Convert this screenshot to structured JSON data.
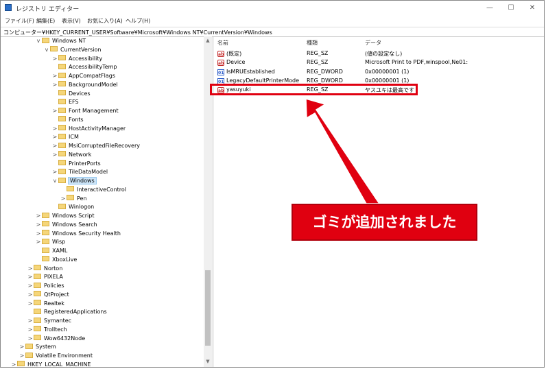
{
  "window": {
    "title": "レジストリ エディター",
    "minimize": "—",
    "maximize": "☐",
    "close": "✕"
  },
  "menu": [
    "ファイル(F)",
    "編集(E)",
    "表示(V)",
    "お気に入り(A)",
    "ヘルプ(H)"
  ],
  "address": "コンピューター¥HKEY_CURRENT_USER¥Software¥Microsoft¥Windows NT¥CurrentVersion¥Windows",
  "tree": [
    {
      "label": "Windows NT",
      "level": 4,
      "expander": "v"
    },
    {
      "label": "CurrentVersion",
      "level": 5,
      "expander": "v"
    },
    {
      "label": "Accessibility",
      "level": 6,
      "expander": ">"
    },
    {
      "label": "AccessibilityTemp",
      "level": 6,
      "expander": ""
    },
    {
      "label": "AppCompatFlags",
      "level": 6,
      "expander": ">"
    },
    {
      "label": "BackgroundModel",
      "level": 6,
      "expander": ">"
    },
    {
      "label": "Devices",
      "level": 6,
      "expander": ""
    },
    {
      "label": "EFS",
      "level": 6,
      "expander": ""
    },
    {
      "label": "Font Management",
      "level": 6,
      "expander": ">"
    },
    {
      "label": "Fonts",
      "level": 6,
      "expander": ""
    },
    {
      "label": "HostActivityManager",
      "level": 6,
      "expander": ">"
    },
    {
      "label": "ICM",
      "level": 6,
      "expander": ">"
    },
    {
      "label": "MsiCorruptedFileRecovery",
      "level": 6,
      "expander": ">"
    },
    {
      "label": "Network",
      "level": 6,
      "expander": ">"
    },
    {
      "label": "PrinterPorts",
      "level": 6,
      "expander": ""
    },
    {
      "label": "TileDataModel",
      "level": 6,
      "expander": ">"
    },
    {
      "label": "Windows",
      "level": 6,
      "expander": "v",
      "selected": true
    },
    {
      "label": "InteractiveControl",
      "level": 7,
      "expander": ""
    },
    {
      "label": "Pen",
      "level": 7,
      "expander": ">"
    },
    {
      "label": "Winlogon",
      "level": 6,
      "expander": ""
    },
    {
      "label": "Windows Script",
      "level": 4,
      "expander": ">"
    },
    {
      "label": "Windows Search",
      "level": 4,
      "expander": ">"
    },
    {
      "label": "Windows Security Health",
      "level": 4,
      "expander": ">"
    },
    {
      "label": "Wisp",
      "level": 4,
      "expander": ">"
    },
    {
      "label": "XAML",
      "level": 4,
      "expander": ""
    },
    {
      "label": "XboxLive",
      "level": 4,
      "expander": ""
    },
    {
      "label": "Norton",
      "level": 3,
      "expander": ">"
    },
    {
      "label": "PIXELA",
      "level": 3,
      "expander": ">"
    },
    {
      "label": "Policies",
      "level": 3,
      "expander": ">"
    },
    {
      "label": "QtProject",
      "level": 3,
      "expander": ">"
    },
    {
      "label": "Realtek",
      "level": 3,
      "expander": ">"
    },
    {
      "label": "RegisteredApplications",
      "level": 3,
      "expander": ""
    },
    {
      "label": "Symantec",
      "level": 3,
      "expander": ">"
    },
    {
      "label": "Trolltech",
      "level": 3,
      "expander": ">"
    },
    {
      "label": "Wow6432Node",
      "level": 3,
      "expander": ">"
    },
    {
      "label": "System",
      "level": 2,
      "expander": ">"
    },
    {
      "label": "Volatile Environment",
      "level": 2,
      "expander": ">"
    },
    {
      "label": "HKEY_LOCAL_MACHINE",
      "level": 1,
      "expander": ">"
    }
  ],
  "columns": {
    "name": "名前",
    "type": "種類",
    "data": "データ"
  },
  "values": [
    {
      "icon": "sz",
      "name": "(既定)",
      "type": "REG_SZ",
      "data": "(値の設定なし)"
    },
    {
      "icon": "sz",
      "name": "Device",
      "type": "REG_SZ",
      "data": "Microsoft Print to PDF,winspool,Ne01:"
    },
    {
      "icon": "dw",
      "name": "IsMRUEstablished",
      "type": "REG_DWORD",
      "data": "0x00000001 (1)"
    },
    {
      "icon": "dw",
      "name": "LegacyDefaultPrinterMode",
      "type": "REG_DWORD",
      "data": "0x00000001 (1)"
    },
    {
      "icon": "sz",
      "name": "yasuyuki",
      "type": "REG_SZ",
      "data": "ヤスユキは最高です"
    }
  ],
  "annotation": "ゴミが追加されました",
  "colors": {
    "highlight": "#e00010",
    "selection": "#cce4f7",
    "folder": "#f5d67a"
  }
}
